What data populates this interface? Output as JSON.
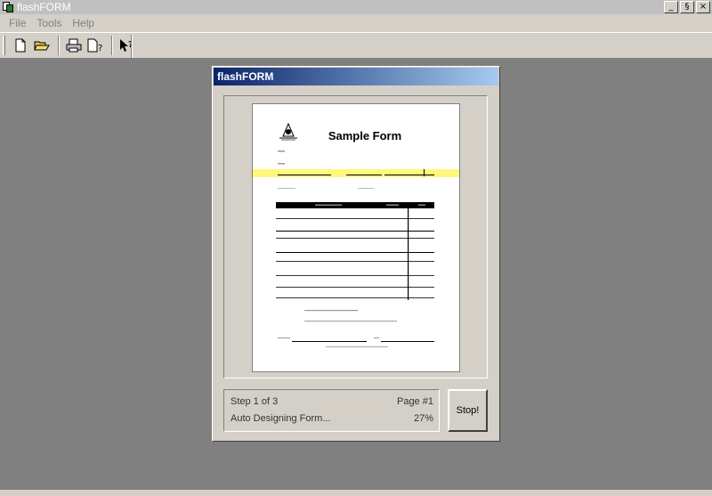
{
  "window": {
    "title": "flashFORM",
    "minimize": "_",
    "restore": "§",
    "close": "×"
  },
  "menu": {
    "items": [
      "File",
      "Tools",
      "Help"
    ]
  },
  "toolbar": {
    "buttons": [
      "new-icon",
      "open-icon",
      "print-icon",
      "print-preview-icon",
      "context-help-icon"
    ]
  },
  "dialog": {
    "title": "flashFORM",
    "preview": {
      "form_title": "Sample Form"
    },
    "status": {
      "step": "Step 1 of 3",
      "page": "Page #1",
      "task": "Auto Designing Form...",
      "percent": "27%"
    },
    "stop_label": "Stop!"
  },
  "colors": {
    "highlight_band": "#fff87a",
    "title_gradient_start": "#0a246a",
    "title_gradient_end": "#a6caf0"
  }
}
